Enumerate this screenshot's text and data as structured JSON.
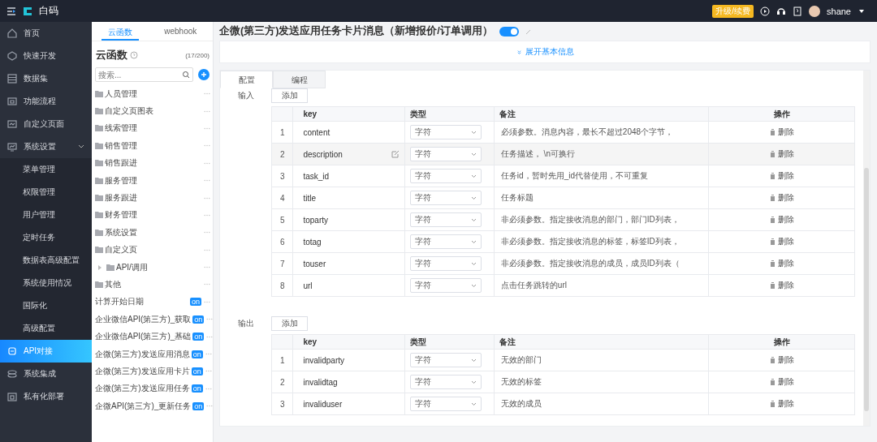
{
  "top_bar": {
    "logo_text": "白码",
    "badge": "升级/续费",
    "user": "shane"
  },
  "sidebar": {
    "items": [
      {
        "label": "首页",
        "selected": false
      },
      {
        "label": "快速开发",
        "selected": false
      },
      {
        "label": "数据集",
        "selected": false
      },
      {
        "label": "功能流程",
        "selected": false
      },
      {
        "label": "自定义页面",
        "selected": false
      },
      {
        "label": "系统设置",
        "selected": false,
        "expanded": true,
        "children": [
          {
            "label": "菜单管理",
            "selected": false
          },
          {
            "label": "权限管理",
            "selected": false
          },
          {
            "label": "用户管理",
            "selected": false
          },
          {
            "label": "定时任务",
            "selected": false
          },
          {
            "label": "数据表高级配置",
            "selected": false
          },
          {
            "label": "系统使用情况",
            "selected": false
          },
          {
            "label": "国际化",
            "selected": false
          },
          {
            "label": "高级配置",
            "selected": false
          }
        ]
      },
      {
        "label": "API对接",
        "selected": true
      },
      {
        "label": "系统集成",
        "selected": false
      },
      {
        "label": "私有化部署",
        "selected": false
      }
    ]
  },
  "functions_panel": {
    "tabs": [
      {
        "label": "云函数",
        "selected": true
      },
      {
        "label": "webhook",
        "selected": false
      }
    ],
    "heading": "云函数",
    "count": "(17/200)",
    "search": {
      "placeholder": "搜索..."
    },
    "items": [
      {
        "kind": "folder",
        "label": "人员管理"
      },
      {
        "kind": "folder",
        "label": "自定义页图表"
      },
      {
        "kind": "folder",
        "label": "线索管理"
      },
      {
        "kind": "folder",
        "label": "销售管理"
      },
      {
        "kind": "folder",
        "label": "销售跟进"
      },
      {
        "kind": "folder",
        "label": "服务管理"
      },
      {
        "kind": "folder",
        "label": "服务跟进"
      },
      {
        "kind": "folder",
        "label": "财务管理"
      },
      {
        "kind": "folder",
        "label": "系统设置"
      },
      {
        "kind": "folder",
        "label": "自定义页"
      },
      {
        "kind": "folder",
        "label": "API/调用",
        "expanded": false
      },
      {
        "kind": "folder",
        "label": "其他"
      },
      {
        "kind": "function",
        "label": "计算开始日期",
        "badge": "on"
      },
      {
        "kind": "function",
        "label": "企业微信API(第三方)_获取",
        "badge": "on"
      },
      {
        "kind": "function",
        "label": "企业微信API(第三方)_基础",
        "badge": "on"
      },
      {
        "kind": "function",
        "label": "企微(第三方)发送应用消息",
        "badge": "on"
      },
      {
        "kind": "function",
        "label": "企微(第三方)发送应用卡片",
        "badge": "on"
      },
      {
        "kind": "function",
        "label": "企微(第三方)发送应用任务",
        "badge": "on"
      },
      {
        "kind": "function",
        "label": "企微API(第三方)_更新任务",
        "badge": "on"
      }
    ]
  },
  "main": {
    "title": "企微(第三方)发送应用任务卡片消息（新增报价/订单调用）",
    "enabled": true,
    "expand_link": "展开基本信息",
    "tabs": [
      {
        "label": "配置",
        "selected": true
      },
      {
        "label": "编程",
        "selected": false
      }
    ],
    "sections": [
      {
        "label": "输入",
        "add_button": "添加",
        "columns": [
          "key",
          "类型",
          "备注",
          "操作"
        ],
        "rows": [
          {
            "index": "1",
            "key": "content",
            "type": "字符",
            "note": "必须参数。消息内容，最长不超过2048个字节，",
            "action": "删除",
            "highlighted": false
          },
          {
            "index": "2",
            "key": "description",
            "type": "字符",
            "note": "任务描述， \\n可换行",
            "action": "删除",
            "highlighted": true
          },
          {
            "index": "3",
            "key": "task_id",
            "type": "字符",
            "note": "任务id，暂时先用_id代替使用，不可重复",
            "action": "删除",
            "highlighted": false
          },
          {
            "index": "4",
            "key": "title",
            "type": "字符",
            "note": "任务标题",
            "action": "删除",
            "highlighted": false
          },
          {
            "index": "5",
            "key": "toparty",
            "type": "字符",
            "note": "非必须参数。指定接收消息的部门，部门ID列表，",
            "action": "删除",
            "highlighted": false
          },
          {
            "index": "6",
            "key": "totag",
            "type": "字符",
            "note": "非必须参数。指定接收消息的标签，标签ID列表，",
            "action": "删除",
            "highlighted": false
          },
          {
            "index": "7",
            "key": "touser",
            "type": "字符",
            "note": "非必须参数。指定接收消息的成员，成员ID列表（",
            "action": "删除",
            "highlighted": false
          },
          {
            "index": "8",
            "key": "url",
            "type": "字符",
            "note": "点击任务跳转的url",
            "action": "删除",
            "highlighted": false
          }
        ]
      },
      {
        "label": "输出",
        "add_button": "添加",
        "columns": [
          "key",
          "类型",
          "备注",
          "操作"
        ],
        "rows": [
          {
            "index": "1",
            "key": "invalidparty",
            "type": "字符",
            "note": "无效的部门",
            "action": "删除",
            "highlighted": false
          },
          {
            "index": "2",
            "key": "invalidtag",
            "type": "字符",
            "note": "无效的标签",
            "action": "删除",
            "highlighted": false
          },
          {
            "index": "3",
            "key": "invaliduser",
            "type": "字符",
            "note": "无效的成员",
            "action": "删除",
            "highlighted": false
          }
        ]
      }
    ]
  }
}
